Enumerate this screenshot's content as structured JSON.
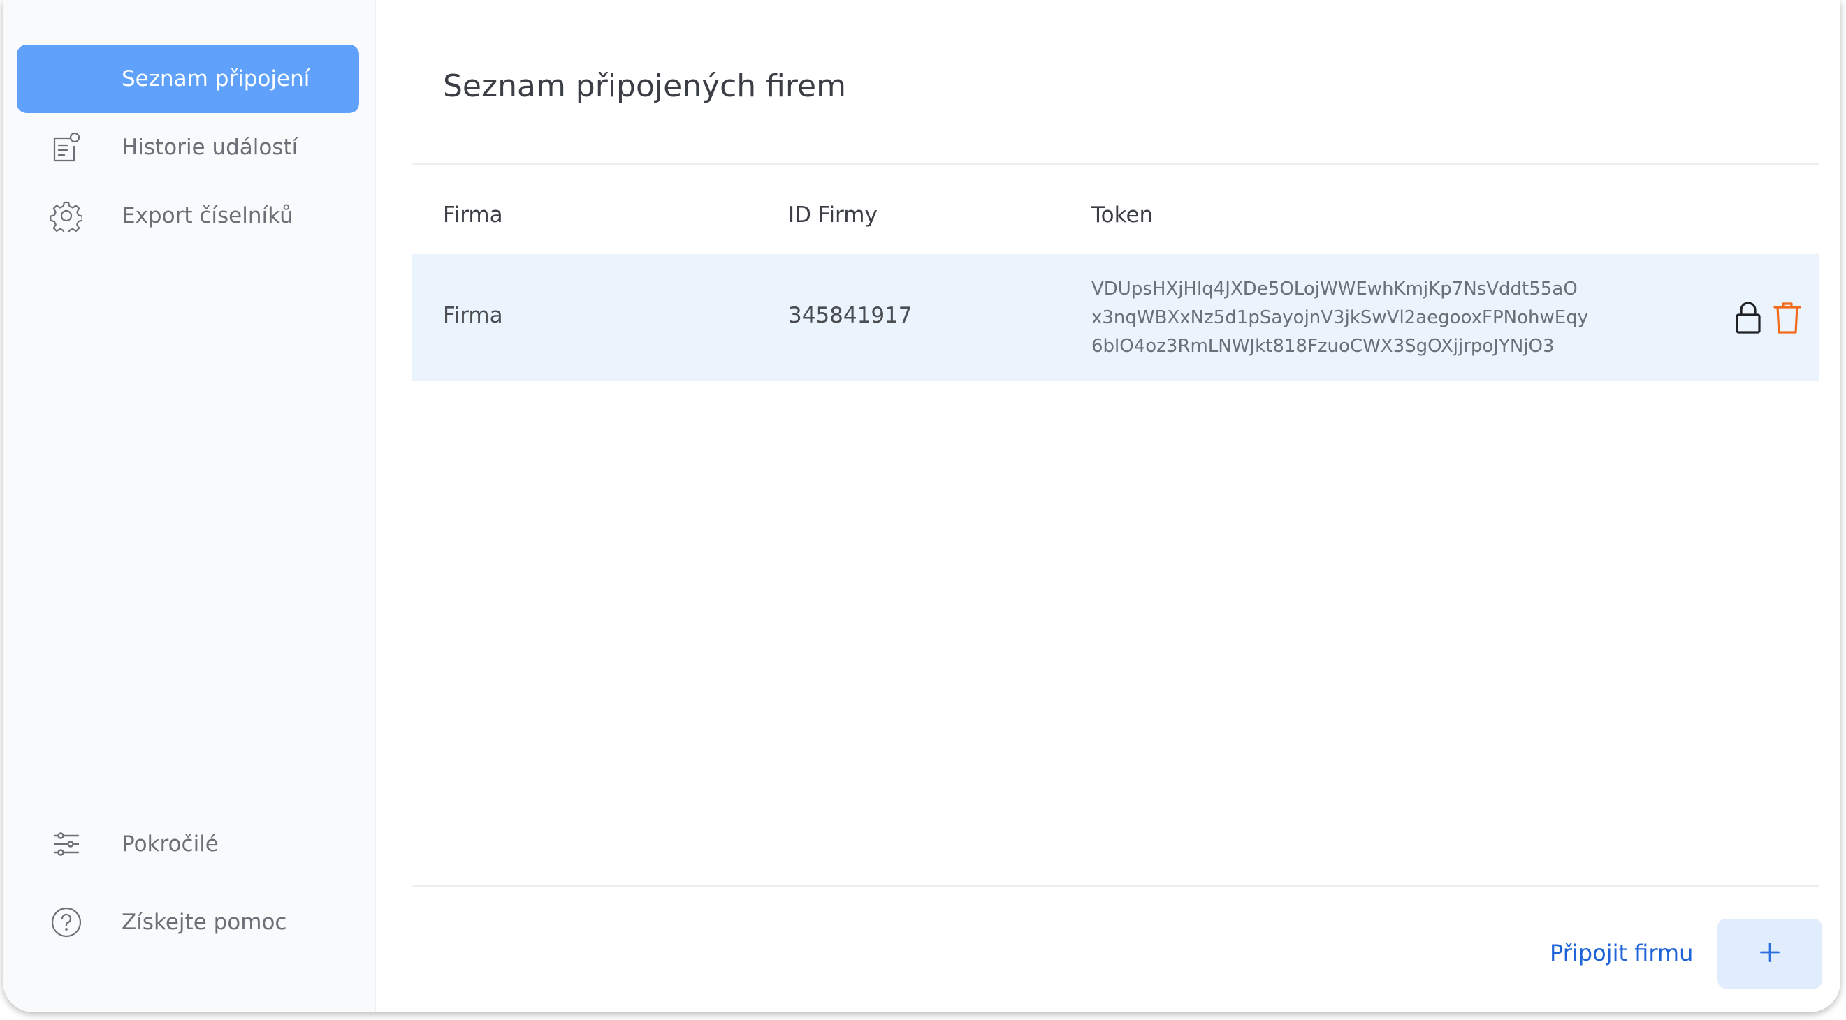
{
  "sidebar": {
    "items": [
      {
        "label": "Seznam připojení",
        "icon": "link-icon",
        "active": true
      },
      {
        "label": "Historie událostí",
        "icon": "document-history-icon",
        "active": false
      },
      {
        "label": "Export číselníků",
        "icon": "gear-icon",
        "active": false
      }
    ],
    "bottom_items": [
      {
        "label": "Pokročilé",
        "icon": "sliders-icon"
      },
      {
        "label": "Získejte pomoc",
        "icon": "help-icon"
      }
    ]
  },
  "main": {
    "title": "Seznam připojených firem",
    "table": {
      "columns": [
        "Firma",
        "ID Firmy",
        "Token"
      ],
      "rows": [
        {
          "firma": "Firma",
          "id": "345841917",
          "token_lines": [
            "VDUpsHXjHlq4JXDe5OLojWWEwhKmjKp7NsVddt55aO",
            "x3nqWBXxNz5d1pSayojnV3jkSwVl2aegooxFPNohwEqy",
            "6blO4oz3RmLNWJkt818FzuoCWX3SgOXjjrpoJYNjO3"
          ],
          "actions": [
            "lock-icon",
            "trash-icon"
          ]
        }
      ]
    },
    "footer": {
      "link_label": "Připojit firmu",
      "add_button_icon": "plus-icon"
    }
  },
  "colors": {
    "accent": "#5fa1fb",
    "row_highlight": "#ebf3fd",
    "link": "#1f63d8",
    "delete": "#f26b1d"
  }
}
